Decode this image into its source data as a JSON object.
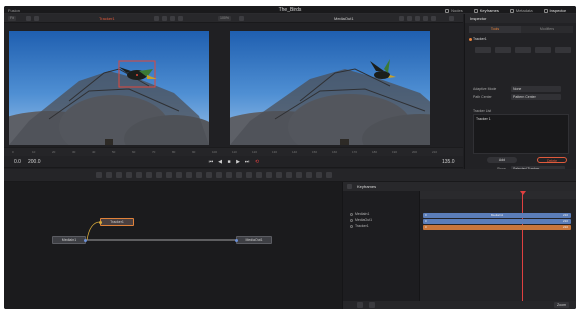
{
  "app": {
    "name": "Fusion",
    "project_title": "The_Birds",
    "workspace_tabs": [
      {
        "label": "Nodes",
        "icon": "nodes-icon"
      },
      {
        "label": "Keyframes",
        "icon": "keyframes-icon"
      },
      {
        "label": "Metadata",
        "icon": "metadata-icon"
      },
      {
        "label": "Inspector",
        "icon": "inspector-icon"
      }
    ]
  },
  "viewer_toolbar": {
    "left_zoom": "Fit",
    "left_clip": "Tracker1",
    "right_zoom": "100%",
    "right_clip": "MediaOut1"
  },
  "ruler": {
    "ticks": [
      "0",
      "10",
      "20",
      "30",
      "40",
      "50",
      "60",
      "70",
      "80",
      "90",
      "100",
      "110",
      "120",
      "130",
      "140",
      "150",
      "160",
      "170",
      "180",
      "190",
      "200",
      "210"
    ]
  },
  "transport": {
    "start_frame": "0.0",
    "end_frame": "200.0",
    "current_frame": "135.0"
  },
  "nodes": {
    "media_in": "MediaIn1",
    "tracker": "Tracker1",
    "media_out": "MediaOut1"
  },
  "keyframes": {
    "panel_title": "Keyframes",
    "items": [
      "MediaIn1",
      "MediaOut1",
      "Tracker1"
    ],
    "bars": [
      {
        "label": "MediaIn1",
        "value": "0",
        "end": "210",
        "color": "#5b7db8"
      },
      {
        "label": "",
        "value": "0",
        "end": "210",
        "color": "#5b7db8"
      },
      {
        "label": "",
        "value": "0",
        "end": "210",
        "color": "#c9763a"
      }
    ],
    "zoom_label": "Zoom"
  },
  "inspector": {
    "title": "Inspector",
    "tabs": [
      "Tools",
      "Modifiers"
    ],
    "tool_name": "Tracker1",
    "rows": [
      {
        "label": "Adaptive Mode",
        "value": "None"
      },
      {
        "label": "Path Center",
        "value": "Pattern Center"
      }
    ],
    "tracker_list_label": "Tracker List",
    "tracker_entry": "Tracker 1",
    "add_button": "Add",
    "delete_button": "Delete",
    "show_label": "Show",
    "show_value": "Selected Tracker"
  },
  "colors": {
    "accent": "#e7823c",
    "track_blue": "#5b7db8",
    "track_orange": "#c9763a",
    "playhead": "#e04040"
  }
}
